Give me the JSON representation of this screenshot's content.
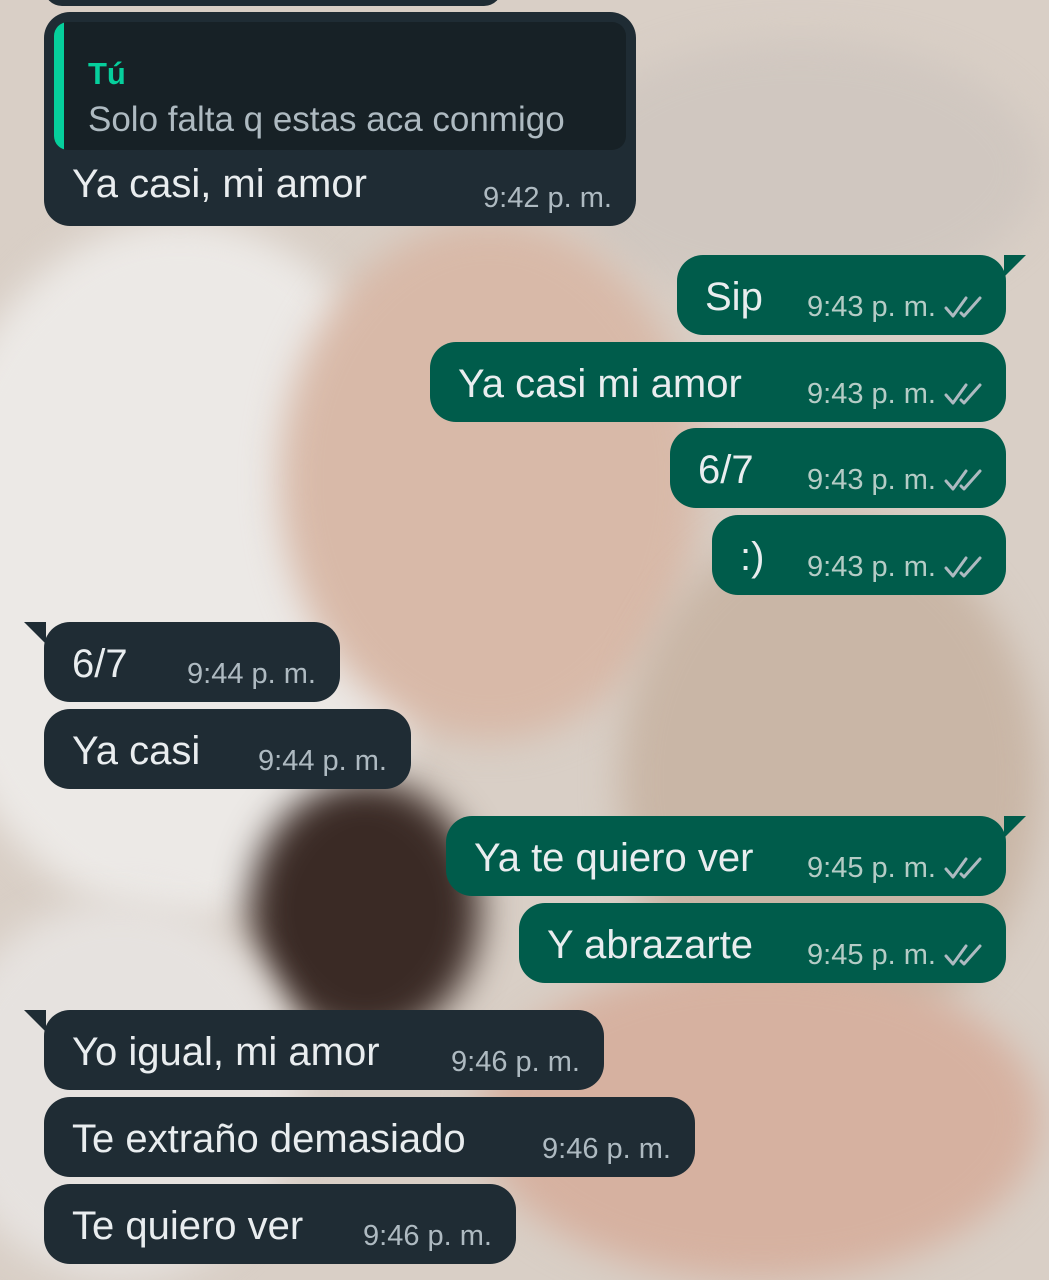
{
  "colors": {
    "incoming_bubble": "#1f2c34",
    "outgoing_bubble": "#005c4b",
    "quote_accent": "#06cf9c",
    "read_ticks": "#aebac1"
  },
  "icons": {
    "read_receipt": "double-check-icon"
  },
  "messages": [
    {
      "direction": "in",
      "quote": {
        "author": "Tú",
        "text": "Solo falta q estas aca conmigo"
      },
      "text": "Ya casi, mi amor",
      "time": "9:42 p. m."
    },
    {
      "direction": "out",
      "text": "Sip",
      "time": "9:43 p. m."
    },
    {
      "direction": "out",
      "text": "Ya casi mi amor",
      "time": "9:43 p. m."
    },
    {
      "direction": "out",
      "text": "6/7",
      "time": "9:43 p. m."
    },
    {
      "direction": "out",
      "text": ":)",
      "time": "9:43 p. m."
    },
    {
      "direction": "in",
      "text": "6/7",
      "time": "9:44 p. m."
    },
    {
      "direction": "in",
      "text": "Ya casi",
      "time": "9:44 p. m."
    },
    {
      "direction": "out",
      "text": "Ya te quiero ver",
      "time": "9:45 p. m."
    },
    {
      "direction": "out",
      "text": "Y abrazarte",
      "time": "9:45 p. m."
    },
    {
      "direction": "in",
      "text": "Yo igual, mi amor",
      "time": "9:46 p. m."
    },
    {
      "direction": "in",
      "text": "Te extraño demasiado",
      "time": "9:46 p. m."
    },
    {
      "direction": "in",
      "text": "Te quiero ver",
      "time": "9:46 p. m."
    }
  ]
}
